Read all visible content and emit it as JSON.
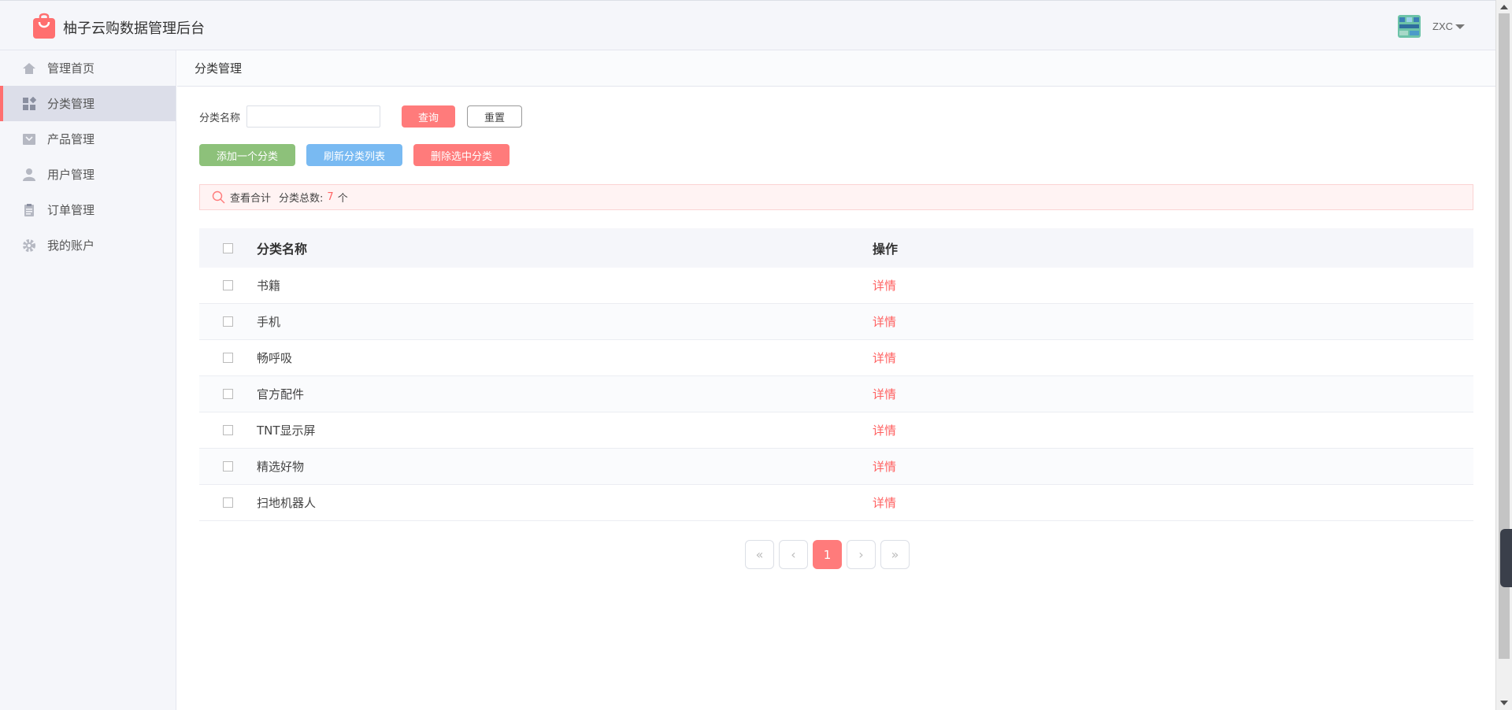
{
  "app": {
    "title": "柚子云购数据管理后台"
  },
  "user": {
    "name": "ZXC"
  },
  "sidebar": {
    "items": [
      {
        "label": "管理首页",
        "icon": "home-icon"
      },
      {
        "label": "分类管理",
        "icon": "category-icon",
        "active": true
      },
      {
        "label": "产品管理",
        "icon": "product-icon"
      },
      {
        "label": "用户管理",
        "icon": "user-icon"
      },
      {
        "label": "订单管理",
        "icon": "order-icon"
      },
      {
        "label": "我的账户",
        "icon": "gear-icon"
      }
    ]
  },
  "breadcrumb": "分类管理",
  "search": {
    "label": "分类名称",
    "value": "",
    "placeholder": ""
  },
  "buttons": {
    "query": "查询",
    "reset": "重置",
    "add": "添加一个分类",
    "refresh": "刷新分类列表",
    "delete": "删除选中分类"
  },
  "summary": {
    "title": "查看合计",
    "label": "分类总数:",
    "count": "7",
    "unit": "个"
  },
  "table": {
    "headers": [
      "分类名称",
      "操作"
    ],
    "rows": [
      {
        "name": "书籍",
        "action": "详情"
      },
      {
        "name": "手机",
        "action": "详情"
      },
      {
        "name": "畅呼吸",
        "action": "详情"
      },
      {
        "name": "官方配件",
        "action": "详情"
      },
      {
        "name": "TNT显示屏",
        "action": "详情"
      },
      {
        "name": "精选好物",
        "action": "详情"
      },
      {
        "name": "扫地机器人",
        "action": "详情"
      }
    ]
  },
  "pagination": {
    "first": "«",
    "prev": "‹",
    "current": "1",
    "next": "›",
    "last": "»"
  },
  "colors": {
    "accent": "#ff7b7b",
    "green": "#8dc17a",
    "blue": "#79baf2"
  }
}
